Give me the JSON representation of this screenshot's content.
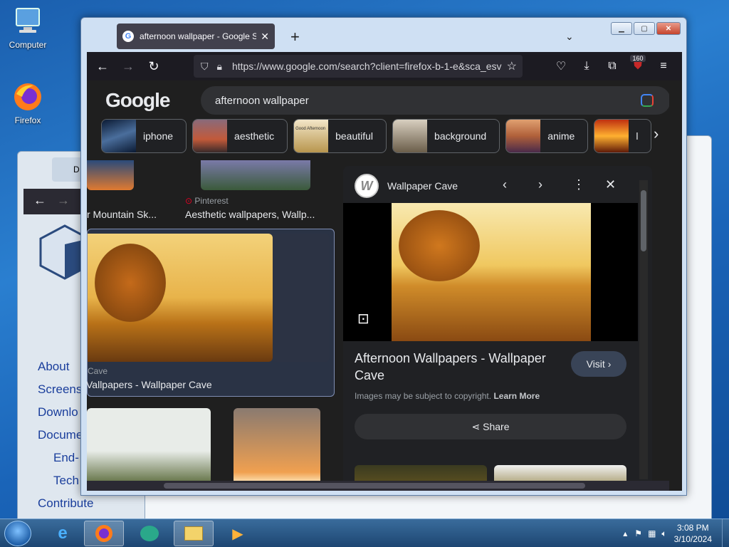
{
  "desktop": {
    "icons": [
      {
        "label": "Computer"
      },
      {
        "label": "Firefox"
      }
    ]
  },
  "background_window": {
    "tab_label": "D",
    "links": [
      "About",
      "Screens",
      "Downlo",
      "Docume",
      "End-",
      "Tech",
      "Contribute"
    ]
  },
  "browser": {
    "tab_title": "afternoon wallpaper - Google Se",
    "url": "https://www.google.com/search?client=firefox-b-1-e&sca_esv",
    "extension_badge": "160"
  },
  "search": {
    "logo": "Google",
    "query": "afternoon wallpaper",
    "chips": [
      {
        "label": "iphone",
        "color": "#2c3e5c"
      },
      {
        "label": "aesthetic",
        "color": "#8a4a34"
      },
      {
        "label": "beautiful",
        "color": "#8a7a5a",
        "thumb_text": "Good Afternoon"
      },
      {
        "label": "background",
        "color": "#6b5e4a"
      },
      {
        "label": "anime",
        "color": "#b0603a"
      },
      {
        "label": "l",
        "color": "#d86a20"
      }
    ]
  },
  "results": [
    {
      "source": "",
      "title": "r Mountain Sk..."
    },
    {
      "source": "Pinterest",
      "title": "Aesthetic wallpapers, Wallp..."
    },
    {
      "source": "Cave",
      "title": "Vallpapers - Wallpaper Cave"
    }
  ],
  "preview": {
    "site": "Wallpaper Cave",
    "title": "Afternoon Wallpapers - Wallpaper Cave",
    "visit_label": "Visit",
    "copyright_text": "Images may be subject to copyright.",
    "learn_more": "Learn More",
    "share_label": "Share"
  },
  "taskbar": {
    "time": "3:08 PM",
    "date": "3/10/2024"
  },
  "colors": {
    "desktop": "#1b5fae",
    "firefox_toolbar": "#1c1b22",
    "google_bg": "#1f1f1f"
  }
}
